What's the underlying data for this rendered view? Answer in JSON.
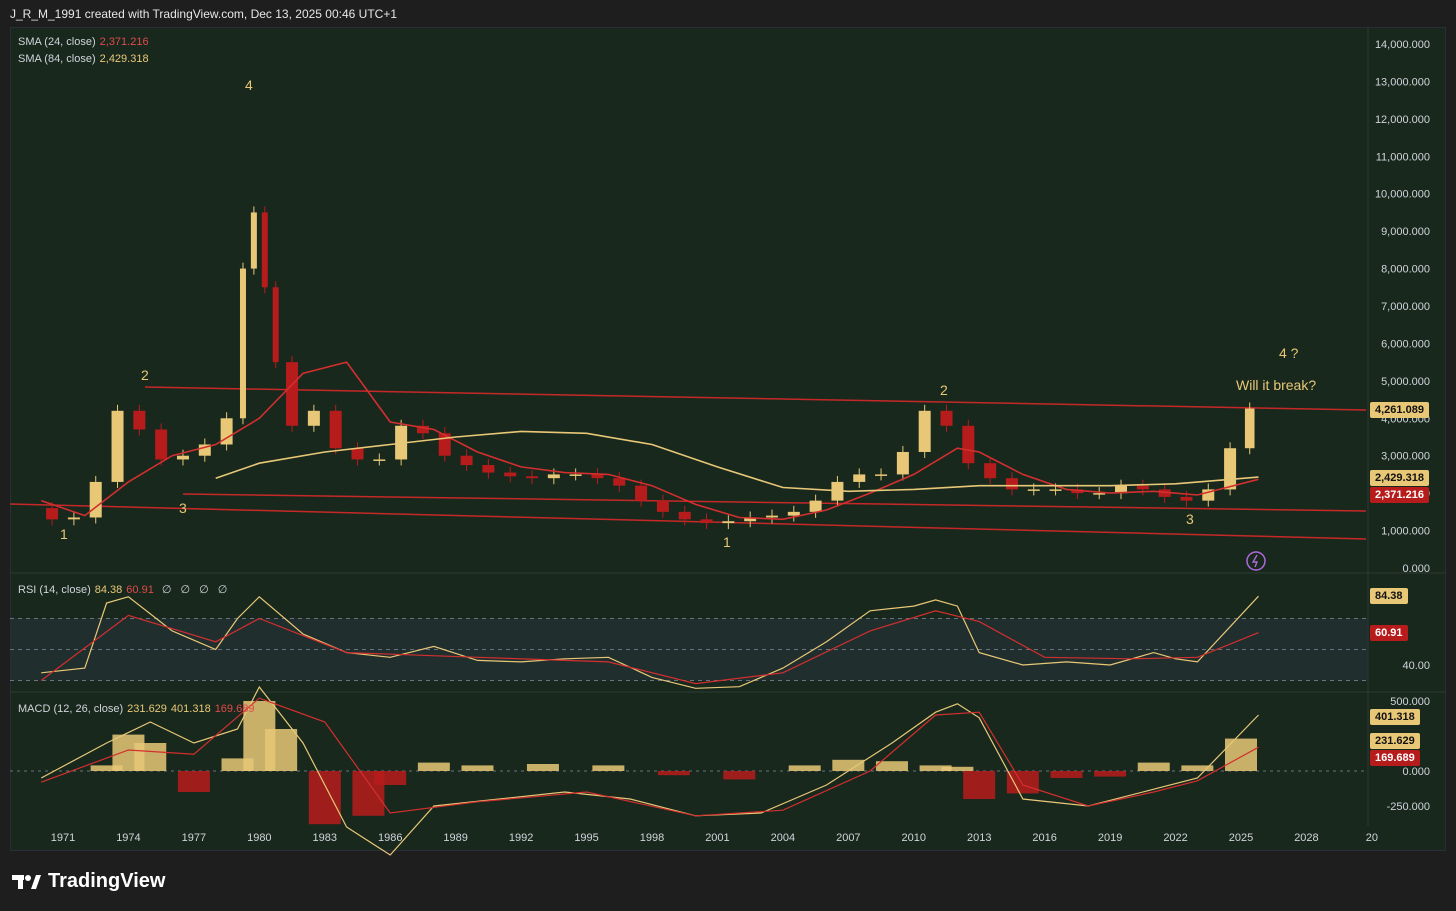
{
  "header": {
    "attribution": "J_R_M_1991 created with TradingView.com, Dec 13, 2025 00:46 UTC+1"
  },
  "footer": {
    "brand": "TradingView",
    "logo_icon": "tradingview-logo-icon"
  },
  "colors": {
    "background": "#18281d",
    "up": "#e8c877",
    "down": "#b71c1c",
    "sma24": "#d32f2f",
    "sma84": "#e8c877",
    "trendline": "#c62828"
  },
  "legends": {
    "sma24": {
      "label": "SMA (24, close)",
      "value": "2,371.216"
    },
    "sma84": {
      "label": "SMA (84, close)",
      "value": "2,429.318"
    },
    "rsi": {
      "label": "RSI (14, close)",
      "v1": "84.38",
      "v2": "60.91",
      "extra": "∅ ∅ ∅ ∅"
    },
    "macd": {
      "label": "MACD (12, 26, close)",
      "v1": "231.629",
      "v2": "401.318",
      "v3": "169.689"
    }
  },
  "annotations": {
    "wave_1a": "1",
    "wave_2a": "2",
    "wave_3a": "3",
    "wave_4a": "4",
    "wave_1b": "1",
    "wave_2b": "2",
    "wave_3b": "3",
    "wave_4b": "4 ?",
    "question": "Will it break?"
  },
  "badges": {
    "price": "4,261.089",
    "sma84": "2,429.318",
    "sma24": "2,371.216",
    "rsi": "84.38",
    "rsi_sma": "60.91",
    "macd_signal": "401.318",
    "macd": "231.629",
    "macd_hist": "169.689"
  },
  "chart_data": [
    {
      "type": "line",
      "subtype": "candlestick",
      "title": "",
      "x_label_ticks": [
        "1971",
        "1974",
        "1977",
        "1980",
        "1983",
        "1986",
        "1989",
        "1992",
        "1995",
        "1998",
        "2001",
        "2004",
        "2007",
        "2010",
        "2013",
        "2016",
        "2019",
        "2022",
        "2025",
        "2028",
        "20"
      ],
      "y_ticks": [
        "14,000.000",
        "13,000.000",
        "12,000.000",
        "11,000.000",
        "10,000.000",
        "9,000.000",
        "8,000.000",
        "7,000.000",
        "6,000.000",
        "5,000.000",
        "4,000.000",
        "3,000.000",
        "2,000.000",
        "1,000.000",
        "0.000"
      ],
      "ylim": [
        0,
        14000
      ],
      "series": [
        {
          "name": "Price",
          "x": [
            1970,
            1971,
            1972,
            1973,
            1974,
            1975,
            1976,
            1977,
            1978,
            1979,
            1979.5,
            1980,
            1980.5,
            1981,
            1982,
            1983,
            1984,
            1985,
            1986,
            1987,
            1988,
            1989,
            1990,
            1991,
            1992,
            1993,
            1994,
            1995,
            1996,
            1997,
            1998,
            1999,
            2000,
            2001,
            2002,
            2003,
            2004,
            2005,
            2006,
            2007,
            2008,
            2009,
            2010,
            2011,
            2012,
            2013,
            2014,
            2015,
            2016,
            2017,
            2018,
            2019,
            2020,
            2021,
            2022,
            2023,
            2024,
            2025,
            2025.8
          ],
          "y": [
            1600,
            1300,
            1350,
            2300,
            4200,
            3700,
            2900,
            3000,
            3300,
            4000,
            8000,
            9500,
            7500,
            5500,
            3800,
            4200,
            3200,
            2900,
            2900,
            3800,
            3600,
            3000,
            2750,
            2550,
            2450,
            2400,
            2500,
            2500,
            2400,
            2200,
            1800,
            1500,
            1300,
            1200,
            1250,
            1350,
            1400,
            1500,
            1800,
            2300,
            2500,
            2500,
            3100,
            4200,
            3800,
            2800,
            2400,
            2100,
            2100,
            2100,
            2000,
            2000,
            2200,
            2100,
            1900,
            1800,
            2100,
            3200,
            4261
          ]
        },
        {
          "name": "SMA (24, close)",
          "x": [
            1970,
            1972,
            1974,
            1976,
            1978,
            1980,
            1982,
            1984,
            1986,
            1988,
            1990,
            1992,
            1994,
            1996,
            1998,
            2000,
            2002,
            2004,
            2006,
            2008,
            2010,
            2012,
            2013,
            2015,
            2017,
            2019,
            2021,
            2023,
            2025.8
          ],
          "y": [
            1800,
            1400,
            2300,
            3000,
            3300,
            4000,
            5200,
            5500,
            3900,
            3700,
            3100,
            2700,
            2550,
            2500,
            2200,
            1700,
            1350,
            1300,
            1550,
            2000,
            2500,
            3200,
            3100,
            2500,
            2100,
            2000,
            2050,
            1950,
            2371
          ]
        },
        {
          "name": "SMA (84, close)",
          "x": [
            1978,
            1980,
            1983,
            1986,
            1989,
            1992,
            1995,
            1998,
            2001,
            2004,
            2007,
            2010,
            2013,
            2016,
            2019,
            2022,
            2025.8
          ],
          "y": [
            2400,
            2800,
            3100,
            3300,
            3500,
            3650,
            3600,
            3300,
            2700,
            2150,
            2050,
            2100,
            2200,
            2200,
            2200,
            2250,
            2429
          ]
        }
      ]
    },
    {
      "type": "line",
      "title": "RSI (14, close)",
      "y_ticks": [
        "40.00"
      ],
      "ylim": [
        20,
        90
      ],
      "bands": [
        30,
        50,
        70
      ],
      "series": [
        {
          "name": "RSI",
          "x": [
            1970,
            1972,
            1973,
            1974,
            1976,
            1978,
            1979,
            1980,
            1982,
            1984,
            1986,
            1988,
            1990,
            1992,
            1994,
            1996,
            1998,
            2000,
            2002,
            2004,
            2006,
            2008,
            2010,
            2011,
            2012,
            2013,
            2015,
            2017,
            2019,
            2021,
            2022,
            2023,
            2025.8
          ],
          "y": [
            35,
            38,
            80,
            84,
            62,
            50,
            70,
            84,
            60,
            48,
            45,
            52,
            43,
            42,
            44,
            45,
            32,
            25,
            26,
            38,
            55,
            75,
            78,
            82,
            78,
            48,
            40,
            42,
            40,
            48,
            44,
            42,
            84.38
          ]
        },
        {
          "name": "RSI SMA",
          "x": [
            1970,
            1974,
            1978,
            1980,
            1984,
            1990,
            1996,
            2000,
            2004,
            2008,
            2011,
            2013,
            2016,
            2020,
            2023,
            2025.8
          ],
          "y": [
            30,
            72,
            55,
            70,
            48,
            45,
            42,
            28,
            35,
            62,
            75,
            68,
            45,
            44,
            45,
            60.91
          ]
        }
      ]
    },
    {
      "type": "bar",
      "title": "MACD (12, 26, close)",
      "y_ticks": [
        "500.000",
        "0.000",
        "-250.000"
      ],
      "ylim": [
        -400,
        550
      ],
      "categories": [
        1973,
        1974,
        1975,
        1977,
        1979,
        1980,
        1981,
        1983,
        1985,
        1986,
        1988,
        1990,
        1993,
        1996,
        1999,
        2002,
        2005,
        2007,
        2009,
        2011,
        2012,
        2013,
        2015,
        2017,
        2019,
        2021,
        2023,
        2025
      ],
      "series": [
        {
          "name": "Histogram",
          "values": [
            40,
            260,
            200,
            -150,
            90,
            500,
            300,
            -380,
            -320,
            -100,
            60,
            40,
            50,
            40,
            -30,
            -60,
            40,
            80,
            70,
            40,
            30,
            -200,
            -160,
            -50,
            -40,
            60,
            40,
            231.629
          ]
        },
        {
          "name": "MACD",
          "x": [
            1970,
            1973,
            1975,
            1977,
            1979,
            1980,
            1982,
            1984,
            1986,
            1988,
            1991,
            1994,
            1997,
            2000,
            2003,
            2006,
            2009,
            2011,
            2012,
            2013,
            2015,
            2018,
            2021,
            2023,
            2025.8
          ],
          "y": [
            -50,
            200,
            350,
            200,
            300,
            600,
            200,
            -400,
            -600,
            -250,
            -200,
            -150,
            -200,
            -320,
            -300,
            -100,
            200,
            420,
            480,
            380,
            -200,
            -250,
            -130,
            -50,
            400
          ]
        },
        {
          "name": "Signal",
          "x": [
            1970,
            1974,
            1977,
            1980,
            1983,
            1986,
            1990,
            1995,
            2000,
            2004,
            2008,
            2011,
            2013,
            2015,
            2018,
            2021,
            2023,
            2025.8
          ],
          "y": [
            -80,
            150,
            120,
            520,
            350,
            -300,
            -220,
            -150,
            -320,
            -280,
            0,
            400,
            420,
            -100,
            -250,
            -150,
            -70,
            170
          ]
        }
      ]
    }
  ]
}
